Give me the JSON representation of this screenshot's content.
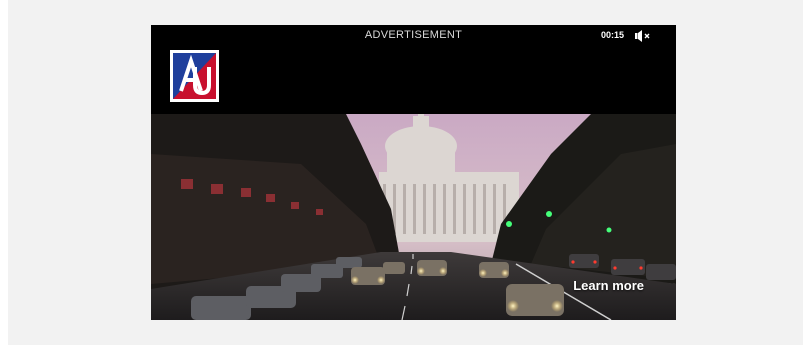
{
  "ad": {
    "label": "ADVERTISEMENT",
    "timer": "00:15",
    "cta_label": "Learn more",
    "colors": {
      "background": "#000000",
      "logo_blue": "#1f3f9c",
      "logo_red": "#c8102e"
    }
  },
  "icons": {
    "mute": "speaker-muted-icon",
    "logo": "american-university-logo"
  }
}
